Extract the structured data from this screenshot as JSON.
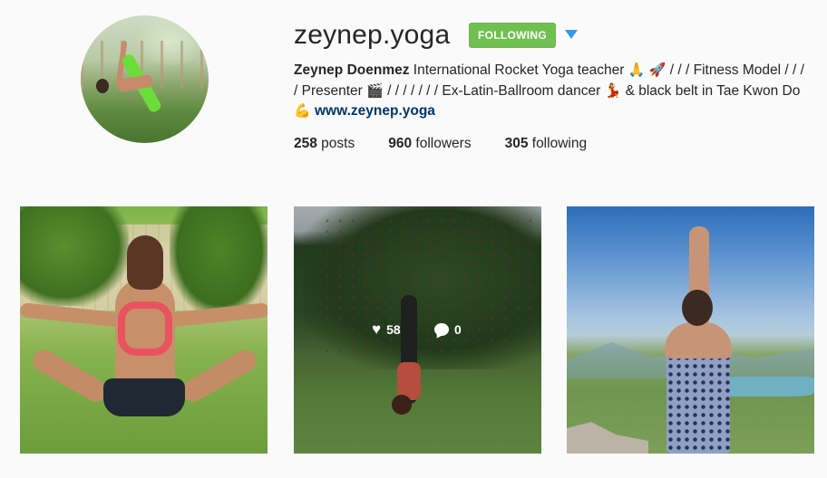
{
  "profile": {
    "username": "zeynep.yoga",
    "follow_label": "FOLLOWING",
    "bio": {
      "name": "Zeynep Doenmez",
      "text_1": " International Rocket Yoga teacher ",
      "emoji_1": "🙏",
      "emoji_2": "🚀",
      "text_2": " / / / Fitness Model / / / / Presenter ",
      "emoji_3": "🎬",
      "text_3": " / / / / / / / Ex-Latin-Ballroom dancer ",
      "emoji_4": "💃",
      "text_4": " & black belt in Tae Kwon Do",
      "emoji_5": "💪",
      "link": "www.zeynep.yoga"
    },
    "stats": {
      "posts_count": "258",
      "posts_label": " posts",
      "followers_count": "960",
      "followers_label": " followers",
      "following_count": "305",
      "following_label": " following"
    }
  },
  "posts": [
    {
      "icon": "yoga-split-photo"
    },
    {
      "icon": "handstand-photo",
      "likes": "58",
      "comments": "0"
    },
    {
      "icon": "mountain-prayer-photo"
    }
  ],
  "colors": {
    "follow_green": "#70c050",
    "link_blue": "#003569",
    "dropdown_blue": "#3897f0"
  }
}
